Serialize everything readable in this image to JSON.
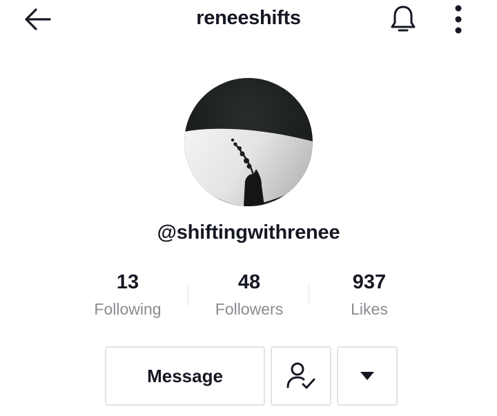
{
  "header": {
    "title": "reneeshifts",
    "back_icon": "back-arrow-icon",
    "notification_icon": "bell-icon",
    "more_icon": "more-vertical-icon"
  },
  "profile": {
    "handle": "@shiftingwithrenee",
    "avatar": "profile-photo"
  },
  "stats": [
    {
      "value": "13",
      "label": "Following"
    },
    {
      "value": "48",
      "label": "Followers"
    },
    {
      "value": "937",
      "label": "Likes"
    }
  ],
  "actions": {
    "message_label": "Message",
    "following_icon": "user-check-icon",
    "dropdown_icon": "caret-down-icon"
  },
  "colors": {
    "text_primary": "#161823",
    "text_secondary": "#8a8b91",
    "border": "#e3e3e4",
    "background": "#ffffff"
  }
}
